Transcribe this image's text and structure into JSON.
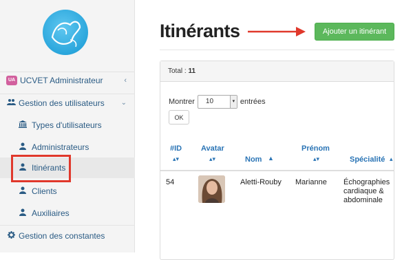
{
  "sidebar": {
    "header": {
      "badge": "UA",
      "label": "UCVET Administrateur",
      "chevron": "‹"
    },
    "section": {
      "label": "Gestion des utilisateurs",
      "chevron": "⌄",
      "icon": "users-icon"
    },
    "items": [
      {
        "label": "Types d'utilisateurs",
        "icon": "bank-icon"
      },
      {
        "label": "Administrateurs",
        "icon": "user-tie-icon"
      },
      {
        "label": "Itinérants",
        "icon": "user-tie-icon",
        "active": true
      },
      {
        "label": "Clients",
        "icon": "user-tie-icon"
      },
      {
        "label": "Auxiliaires",
        "icon": "user-tie-icon"
      }
    ],
    "constants": {
      "label": "Gestion des constantes",
      "icon": "gear-icon"
    }
  },
  "main": {
    "title": "Itinérants",
    "add_button": "Ajouter un itinérant",
    "total_label": "Total :",
    "total_value": "11",
    "length_prefix": "Montrer",
    "length_value": "10",
    "length_suffix": "entrées",
    "ok_button": "OK",
    "columns": [
      "#ID",
      "Avatar",
      "Nom",
      "Prénom",
      "Spécialité"
    ],
    "rows": [
      {
        "id": "54",
        "nom": "Aletti-Rouby",
        "prenom": "Marianne",
        "specialite": "Échographies cardiaque & abdominale"
      }
    ]
  },
  "colors": {
    "accent": "#2a74b5",
    "button_green": "#5cb85c",
    "highlight_red": "#e0382b",
    "badge_pink": "#d2609e"
  }
}
